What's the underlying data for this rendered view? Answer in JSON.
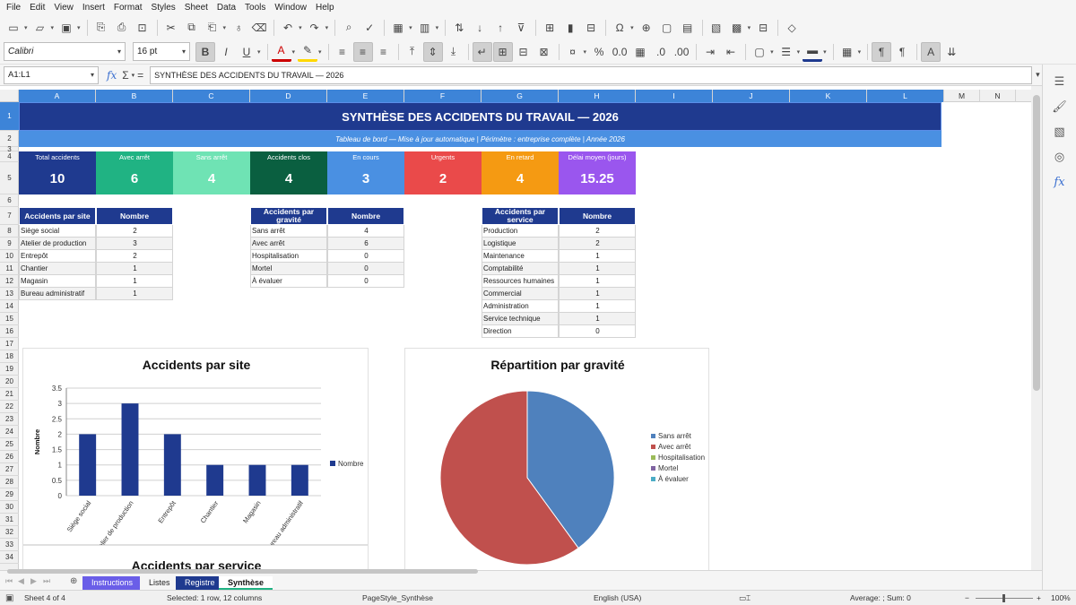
{
  "menu": [
    "File",
    "Edit",
    "View",
    "Insert",
    "Format",
    "Styles",
    "Sheet",
    "Data",
    "Tools",
    "Window",
    "Help"
  ],
  "toolbar": {
    "font_name": "Calibri",
    "font_size": "16 pt"
  },
  "formula_bar": {
    "cell_ref": "A1:L1",
    "formula": "SYNTHÈSE DES ACCIDENTS DU TRAVAIL — 2026"
  },
  "columns": [
    "A",
    "B",
    "C",
    "D",
    "E",
    "F",
    "G",
    "H",
    "I",
    "J",
    "K",
    "L",
    "M",
    "N"
  ],
  "rows": [
    "1",
    "2",
    "3",
    "4",
    "5",
    "6",
    "7",
    "8",
    "9",
    "10",
    "11",
    "12",
    "13",
    "14",
    "15",
    "16",
    "17",
    "18",
    "19",
    "20",
    "21",
    "22",
    "23",
    "24",
    "25",
    "26",
    "27",
    "28",
    "29",
    "30",
    "31",
    "32",
    "33",
    "34"
  ],
  "title": "SYNTHÈSE DES ACCIDENTS DU TRAVAIL — 2026",
  "subtitle": "Tableau de bord — Mise à jour automatique  |  Périmètre : entreprise complète  |  Année 2026",
  "kpis": [
    {
      "label": "Total accidents",
      "value": "10",
      "color": "#1f3a8f"
    },
    {
      "label": "Avec arrêt",
      "value": "6",
      "color": "#20b383"
    },
    {
      "label": "Sans arrêt",
      "value": "4",
      "color": "#6fe3b4"
    },
    {
      "label": "Accidents clos",
      "value": "4",
      "color": "#0a5f40"
    },
    {
      "label": "En cours",
      "value": "3",
      "color": "#4a90e2"
    },
    {
      "label": "Urgents",
      "value": "2",
      "color": "#ea4a4a"
    },
    {
      "label": "En retard",
      "value": "4",
      "color": "#f59a12"
    },
    {
      "label": "Délai moyen (jours)",
      "value": "15.25",
      "color": "#9a56ee"
    }
  ],
  "table_site": {
    "header": [
      "Accidents par site",
      "Nombre"
    ],
    "rows": [
      [
        "Siège social",
        "2"
      ],
      [
        "Atelier de production",
        "3"
      ],
      [
        "Entrepôt",
        "2"
      ],
      [
        "Chantier",
        "1"
      ],
      [
        "Magasin",
        "1"
      ],
      [
        "Bureau administratif",
        "1"
      ]
    ]
  },
  "table_gravite": {
    "header": [
      "Accidents par gravité",
      "Nombre"
    ],
    "rows": [
      [
        "Sans arrêt",
        "4"
      ],
      [
        "Avec arrêt",
        "6"
      ],
      [
        "Hospitalisation",
        "0"
      ],
      [
        "Mortel",
        "0"
      ],
      [
        "À évaluer",
        "0"
      ]
    ]
  },
  "table_service": {
    "header": [
      "Accidents par service",
      "Nombre"
    ],
    "rows": [
      [
        "Production",
        "2"
      ],
      [
        "Logistique",
        "2"
      ],
      [
        "Maintenance",
        "1"
      ],
      [
        "Comptabilité",
        "1"
      ],
      [
        "Ressources humaines",
        "1"
      ],
      [
        "Commercial",
        "1"
      ],
      [
        "Administration",
        "1"
      ],
      [
        "Service technique",
        "1"
      ],
      [
        "Direction",
        "0"
      ]
    ]
  },
  "chart_data": [
    {
      "type": "bar",
      "title": "Accidents par site",
      "categories": [
        "Siège social",
        "Atelier de production",
        "Entrepôt",
        "Chantier",
        "Magasin",
        "Bureau administratif"
      ],
      "series": [
        {
          "name": "Nombre",
          "values": [
            2,
            3,
            2,
            1,
            1,
            1
          ],
          "color": "#1f3a8f"
        }
      ],
      "ylabel": "Nombre",
      "yticks": [
        "0",
        "0.5",
        "1",
        "1.5",
        "2",
        "2.5",
        "3",
        "3.5"
      ],
      "ylim": [
        0,
        3.5
      ],
      "grid": true,
      "legend": "right"
    },
    {
      "type": "pie",
      "title": "Répartition par gravité",
      "categories": [
        "Sans arrêt",
        "Avec arrêt",
        "Hospitalisation",
        "Mortel",
        "À évaluer"
      ],
      "values": [
        4,
        6,
        0,
        0,
        0
      ],
      "colors": [
        "#4f81bd",
        "#c0504d",
        "#9bbb59",
        "#8064a2",
        "#4bacc6"
      ],
      "legend": "right"
    },
    {
      "type": "bar",
      "title": "Accidents par service"
    }
  ],
  "sheet_tabs": [
    {
      "name": "Instructions",
      "color": "#6a5ee8"
    },
    {
      "name": "Listes",
      "color": ""
    },
    {
      "name": "Registre",
      "color": "#1f3a8f"
    },
    {
      "name": "Synthèse",
      "color": "#ffffff"
    }
  ],
  "status": {
    "sheet": "Sheet 4 of 4",
    "selection": "Selected: 1 row, 12 columns",
    "page_style": "PageStyle_Synthèse",
    "language": "English (USA)",
    "summary": "Average: ; Sum: 0",
    "zoom": "100%"
  }
}
